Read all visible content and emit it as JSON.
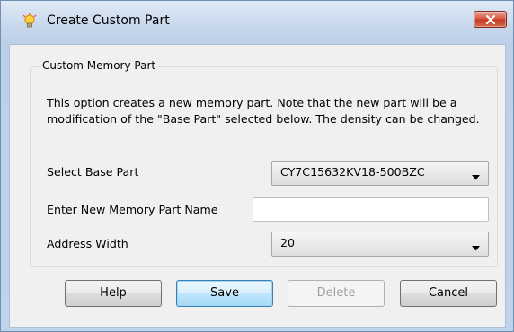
{
  "window": {
    "title": "Create Custom Part",
    "close_label": "close"
  },
  "group": {
    "legend": "Custom Memory Part",
    "description": "This option creates a new memory part. Note that the new part will be a modification of the \"Base Part\" selected below. The density can be changed."
  },
  "fields": {
    "base_part": {
      "label": "Select Base Part",
      "value": "CY7C15632KV18-500BZC"
    },
    "new_name": {
      "label": "Enter New Memory Part Name",
      "value": ""
    },
    "address_width": {
      "label": "Address Width",
      "value": "20"
    }
  },
  "buttons": {
    "help": "Help",
    "save": "Save",
    "delete": "Delete",
    "cancel": "Cancel"
  },
  "colors": {
    "title_bar": "#c6d7ec",
    "close_button": "#d04a32",
    "dialog_background": "#f0f0f0",
    "default_button_border": "#3c7fb1"
  },
  "icons": {
    "app": "lightbulb-icon",
    "close": "close-icon",
    "dropdown": "chevron-down-icon"
  }
}
